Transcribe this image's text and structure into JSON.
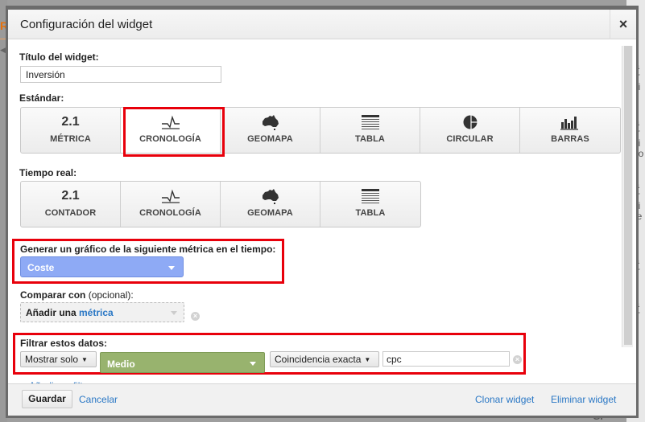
{
  "dialog": {
    "title": "Configuración del widget",
    "close_icon": "×"
  },
  "widget_title": {
    "label": "Título del widget:",
    "value": "Inversión"
  },
  "standard": {
    "label": "Estándar:",
    "selected": "CRONOLOGÍA",
    "options": [
      {
        "icon": "metric-number",
        "icon_text": "2.1",
        "label": "MÉTRICA"
      },
      {
        "icon": "timeline-icon",
        "label": "CRONOLOGÍA"
      },
      {
        "icon": "geomap-icon",
        "label": "GEOMAPA"
      },
      {
        "icon": "table-icon",
        "label": "TABLA"
      },
      {
        "icon": "pie-icon",
        "label": "CIRCULAR"
      },
      {
        "icon": "bar-chart-icon",
        "label": "BARRAS"
      }
    ]
  },
  "realtime": {
    "label": "Tiempo real:",
    "options": [
      {
        "icon": "metric-number",
        "icon_text": "2.1",
        "label": "CONTADOR"
      },
      {
        "icon": "timeline-icon",
        "label": "CRONOLOGÍA"
      },
      {
        "icon": "geomap-icon",
        "label": "GEOMAPA"
      },
      {
        "icon": "table-icon",
        "label": "TABLA"
      }
    ]
  },
  "metric": {
    "label": "Generar un gráfico de la siguiente métrica en el tiempo:",
    "value": "Coste"
  },
  "compare": {
    "label_bold": "Comparar con",
    "label_light": " (opcional):",
    "placeholder_bold": "Añadir una ",
    "placeholder_link": "métrica"
  },
  "filter": {
    "label": "Filtrar estos datos:",
    "mode": "Mostrar solo",
    "dimension": "Medio",
    "match_type": "Coincidencia exacta",
    "value": "cpc",
    "add_filter_link": "Añadir un filtro"
  },
  "footer": {
    "save": "Guardar",
    "cancel": "Cancelar",
    "clone": "Clonar widget",
    "delete": "Eliminar widget"
  },
  "colors": {
    "highlight": "#e8000b",
    "metric_select": "#8eaaf5",
    "dimension_select": "#98b36e",
    "link": "#2b78c5"
  },
  "background": {
    "left_fragment": "R",
    "right_fragments": [
      "D",
      "ta",
      "ar",
      "Di",
      "lo",
      "ta",
      "ar",
      "Di",
      "Co",
      "ta",
      "ar",
      "Di",
      "de",
      "ta",
      "ar",
      "le",
      "a",
      "ta",
      "ar",
      "le",
      "e",
      "Gr"
    ]
  }
}
